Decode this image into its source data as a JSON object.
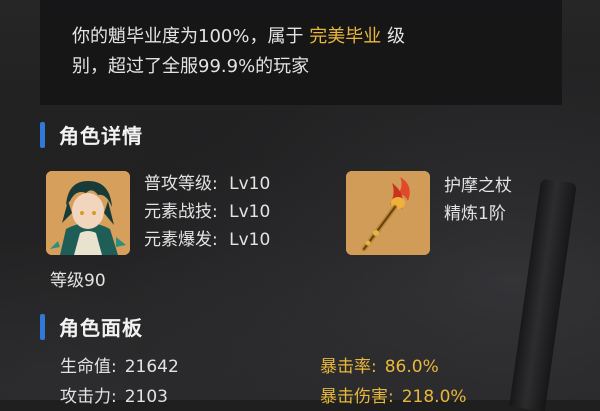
{
  "summary": {
    "prefix": "你的魈毕业度为100%，属于",
    "tier": "完美毕业",
    "middle": "级",
    "suffix": "别，超过了全服99.9%的玩家"
  },
  "sections": {
    "details_title": "角色详情",
    "panel_title": "角色面板"
  },
  "talents": [
    {
      "label": "普攻等级:",
      "value": "Lv10"
    },
    {
      "label": "元素战技:",
      "value": "Lv10"
    },
    {
      "label": "元素爆发:",
      "value": "Lv10"
    }
  ],
  "character": {
    "level": "等级90",
    "portrait_icon": "xiao-portrait-icon"
  },
  "weapon": {
    "name": "护摩之杖",
    "refinement": "精炼1阶",
    "icon": "staff-of-homa-icon"
  },
  "stats": {
    "hp_label": "生命值:",
    "hp_value": "21642",
    "crit_rate_label": "暴击率:",
    "crit_rate_value": "86.0%",
    "atk_label": "攻击力:",
    "atk_value": "2103",
    "crit_dmg_label": "暴击伤害:",
    "crit_dmg_value": "218.0%"
  },
  "colors": {
    "accent_blue": "#2f7ad8",
    "highlight_gold": "#e9b83a",
    "text": "#e3e3e3",
    "portrait_bg": "#d9a560"
  }
}
